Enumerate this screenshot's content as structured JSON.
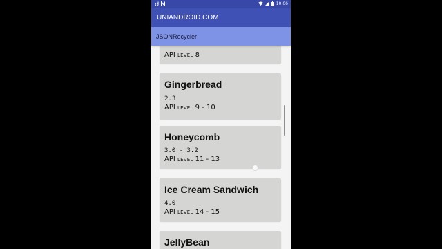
{
  "status_bar": {
    "time": "10:06",
    "left_icons": [
      "download-icon",
      "notification-n-icon"
    ],
    "right_icons": [
      "wifi-icon",
      "signal-icon",
      "battery-icon"
    ]
  },
  "app": {
    "title": "UNIANDROID.COM",
    "toolbar_title": "JSONRecycler"
  },
  "versions": [
    {
      "name": "",
      "version": "",
      "api_prefix": "API",
      "api_level_word": "level",
      "api_range": "8"
    },
    {
      "name": "Gingerbread",
      "version": "2.3",
      "api_prefix": "API",
      "api_level_word": "level",
      "api_range": "9 - 10"
    },
    {
      "name": "Honeycomb",
      "version": "3.0 - 3.2",
      "api_prefix": "API",
      "api_level_word": "level",
      "api_range": "11 - 13"
    },
    {
      "name": "Ice Cream Sandwich",
      "version": "4.0",
      "api_prefix": "API",
      "api_level_word": "level",
      "api_range": "14 - 15"
    },
    {
      "name": "JellyBean",
      "version": "",
      "api_prefix": "",
      "api_level_word": "",
      "api_range": ""
    }
  ],
  "colors": {
    "status_bar": "#3748a8",
    "app_bar": "#3f51b5",
    "toolbar": "#7e92e6",
    "card": "#d5d5d3",
    "background": "#f4f4f4"
  }
}
